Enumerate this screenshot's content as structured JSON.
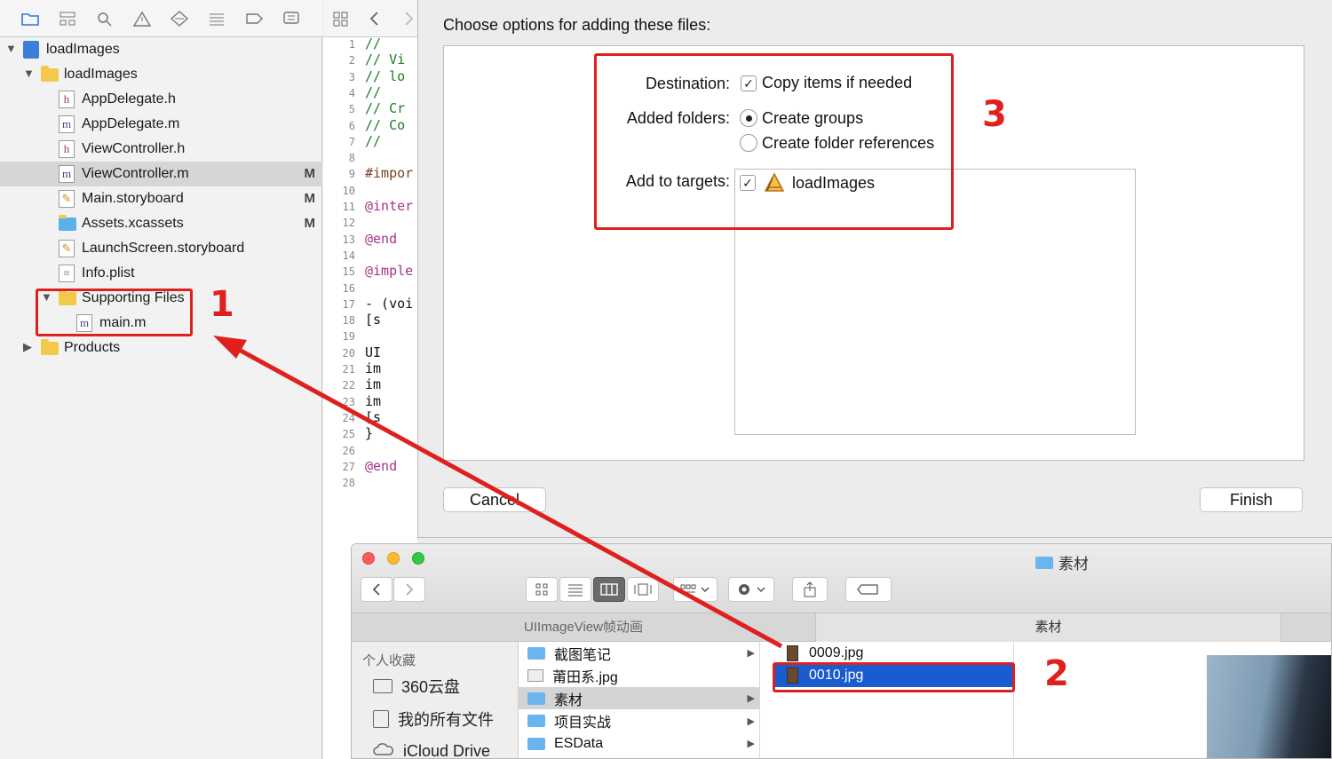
{
  "navigator": {
    "tree": [
      {
        "label": "loadImages",
        "mark": "",
        "kind": "project",
        "disclosure": "▼"
      },
      {
        "label": "loadImages",
        "mark": "",
        "kind": "folder",
        "disclosure": "▼"
      },
      {
        "label": "AppDelegate.h",
        "mark": "",
        "kind": "h"
      },
      {
        "label": "AppDelegate.m",
        "mark": "",
        "kind": "m"
      },
      {
        "label": "ViewController.h",
        "mark": "",
        "kind": "h"
      },
      {
        "label": "ViewController.m",
        "mark": "M",
        "kind": "m",
        "selected": true
      },
      {
        "label": "Main.storyboard",
        "mark": "M",
        "kind": "storyboard"
      },
      {
        "label": "Assets.xcassets",
        "mark": "M",
        "kind": "assets"
      },
      {
        "label": "LaunchScreen.storyboard",
        "mark": "",
        "kind": "storyboard"
      },
      {
        "label": "Info.plist",
        "mark": "",
        "kind": "plist"
      },
      {
        "label": "Supporting Files",
        "mark": "",
        "kind": "folder",
        "disclosure": "▼"
      },
      {
        "label": "main.m",
        "mark": "",
        "kind": "m"
      },
      {
        "label": "Products",
        "mark": "",
        "kind": "folder",
        "disclosure": "▶"
      }
    ]
  },
  "editor": {
    "line_numbers": [
      "1",
      "2",
      "3",
      "4",
      "5",
      "6",
      "7",
      "8",
      "9",
      "10",
      "11",
      "12",
      "13",
      "14",
      "15",
      "16",
      "17",
      "18",
      "19",
      "20",
      "21",
      "22",
      "23",
      "24",
      "25",
      "26",
      "27",
      "28"
    ],
    "code": [
      {
        "line": "1",
        "text": "//",
        "cls": "c-comment"
      },
      {
        "line": "2",
        "text": "//  Vi",
        "cls": "c-comment"
      },
      {
        "line": "3",
        "text": "//  lo",
        "cls": "c-comment"
      },
      {
        "line": "4",
        "text": "//",
        "cls": "c-comment"
      },
      {
        "line": "5",
        "text": "//  Cr",
        "cls": "c-comment"
      },
      {
        "line": "6",
        "text": "//  Co",
        "cls": "c-comment"
      },
      {
        "line": "7",
        "text": "//",
        "cls": "c-comment"
      },
      {
        "line": "9",
        "text": "#impor",
        "cls": "c-dir"
      },
      {
        "line": "11",
        "text": "@inter",
        "cls": "c-kw"
      },
      {
        "line": "13",
        "text": "@end",
        "cls": "c-kw"
      },
      {
        "line": "15",
        "text": "@imple",
        "cls": "c-kw"
      },
      {
        "line": "17",
        "text": "- (voi",
        "cls": "c-plain"
      },
      {
        "line": "18",
        "text": "    [s",
        "cls": "c-plain"
      },
      {
        "line": "20",
        "text": "    UI",
        "cls": "c-plain"
      },
      {
        "line": "21",
        "text": "    im",
        "cls": "c-plain"
      },
      {
        "line": "22",
        "text": "    im",
        "cls": "c-plain"
      },
      {
        "line": "23",
        "text": "    im",
        "cls": "c-plain"
      },
      {
        "line": "24",
        "text": "    [s",
        "cls": "c-plain"
      },
      {
        "line": "25",
        "text": "}",
        "cls": "c-plain"
      },
      {
        "line": "27",
        "text": "@end",
        "cls": "c-kw"
      }
    ]
  },
  "sheet": {
    "title": "Choose options for adding these files:",
    "destination_label": "Destination:",
    "copy_items": "Copy items if needed",
    "added_folders_label": "Added folders:",
    "create_groups": "Create groups",
    "create_folder_refs": "Create folder references",
    "add_to_targets_label": "Add to targets:",
    "target_name": "loadImages",
    "cancel": "Cancel",
    "finish": "Finish"
  },
  "finder": {
    "window_title": "素材",
    "tab_left": "UIImageView帧动画",
    "tab_right": "素材",
    "sidebar_header": "个人收藏",
    "sidebar_items": [
      "360云盘",
      "我的所有文件",
      "iCloud Drive"
    ],
    "col1": [
      "截图笔记",
      "莆田系.jpg",
      "素材",
      "项目实战",
      "ESData"
    ],
    "col2": [
      "0009.jpg",
      "0010.jpg"
    ]
  },
  "annotations": {
    "n1": "1",
    "n2": "2",
    "n3": "3",
    "color": "#e0201f"
  }
}
